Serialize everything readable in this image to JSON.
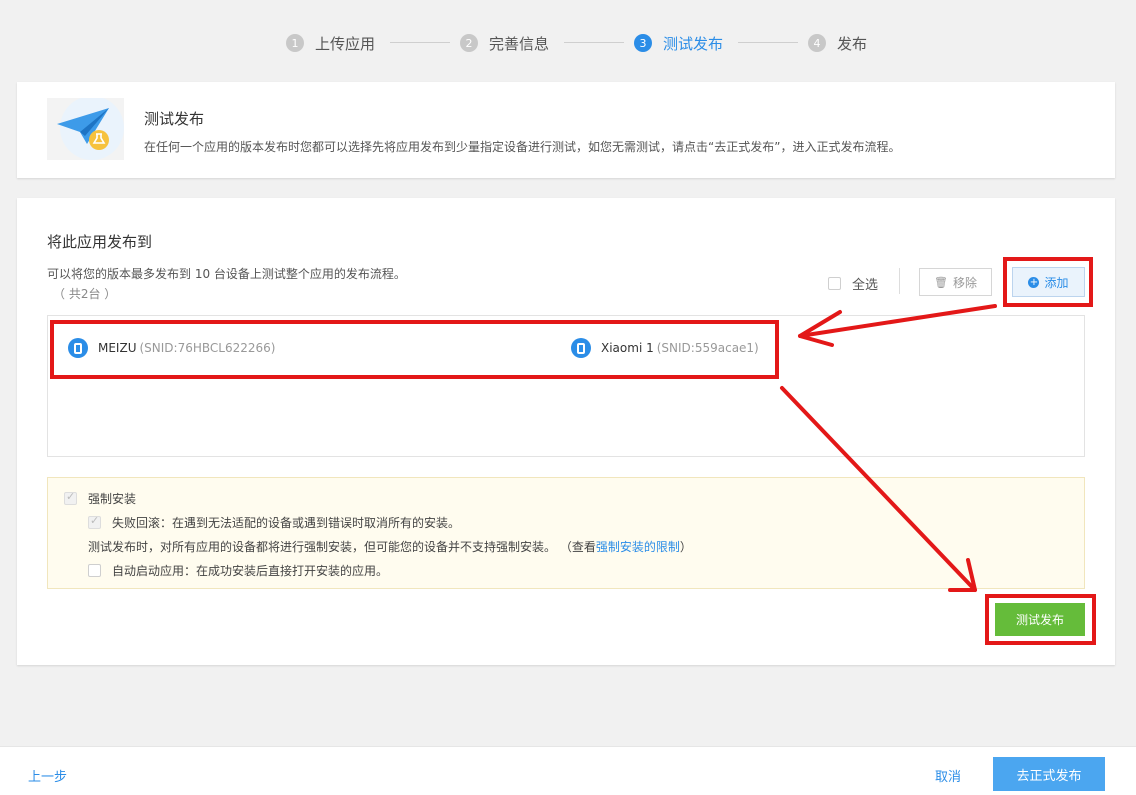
{
  "stepper": {
    "steps": [
      {
        "num": "1",
        "label": "上传应用"
      },
      {
        "num": "2",
        "label": "完善信息"
      },
      {
        "num": "3",
        "label": "测试发布"
      },
      {
        "num": "4",
        "label": "发布"
      }
    ],
    "active_step": 3
  },
  "intro": {
    "icon": "paper-plane-flask-icon",
    "title": "测试发布",
    "description": "在任何一个应用的版本发布时您都可以选择先将应用发布到少量指定设备进行测试，如您无需测试，请点击“去正式发布”，进入正式发布流程。"
  },
  "publish_target": {
    "title": "将此应用发布到",
    "description": "可以将您的版本最多发布到 10 台设备上测试整个应用的发布流程。",
    "count": "（ 共2台 ）",
    "select_all_label": "全选",
    "remove_label": "移除",
    "add_label": "添加",
    "devices": [
      {
        "name": "MEIZU",
        "snid": "(SNID:76HBCL622266)"
      },
      {
        "name": "Xiaomi 1",
        "snid": "(SNID:559acae1)"
      }
    ]
  },
  "force_install": {
    "label": "强制安装",
    "checked": true,
    "rollback_label": "失败回滚：在遇到无法适配的设备或遇到错误时取消所有的安装。",
    "rollback_checked": true,
    "note_prefix": "测试发布时，对所有应用的设备都将进行强制安装，但可能您的设备并不支持强制安装。  （查看",
    "note_link": "强制安装的限制",
    "note_suffix": "）",
    "auto_start_label": "自动启动应用：在成功安装后直接打开安装的应用。",
    "auto_start_checked": false
  },
  "test_publish_button": "测试发布",
  "footer": {
    "prev_label": "上一步",
    "cancel_label": "取消",
    "publish_label": "去正式发布"
  },
  "colors": {
    "accent": "#2b8de7",
    "success": "#65bc3a",
    "annotation": "#e31818"
  }
}
